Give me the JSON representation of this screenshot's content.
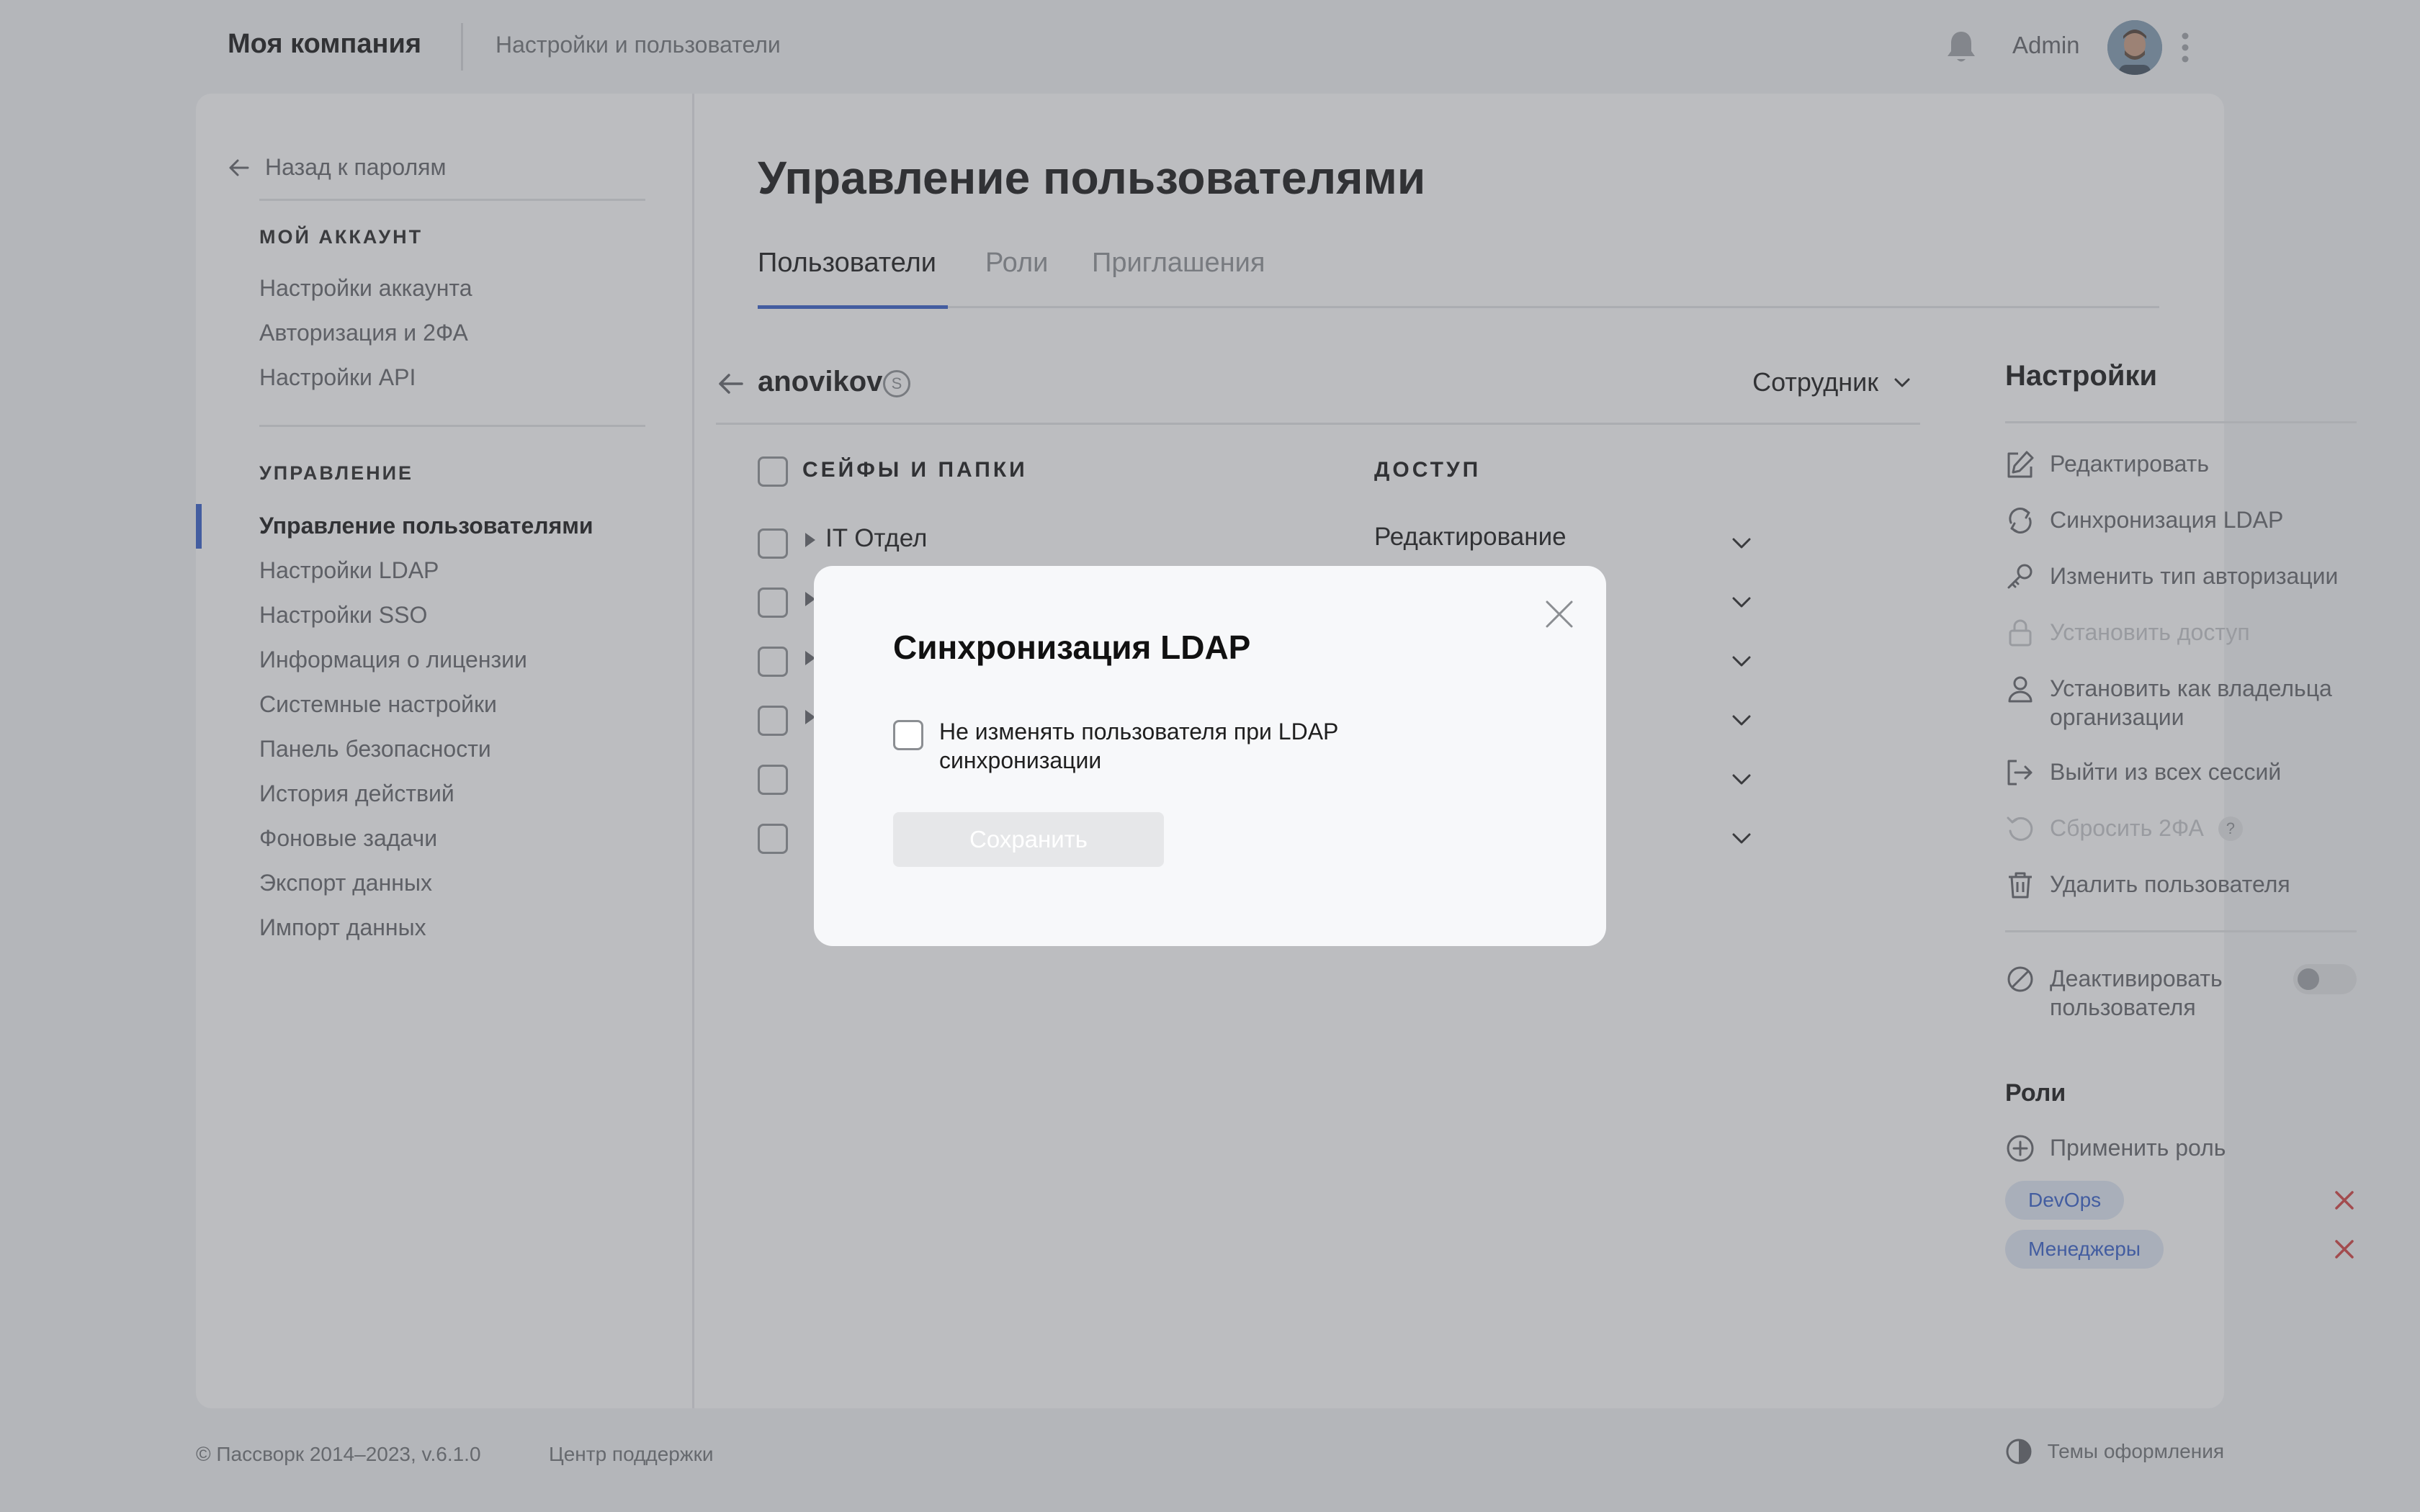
{
  "header": {
    "company": "Моя компания",
    "section": "Настройки и пользователи",
    "user_name": "Admin"
  },
  "sidebar": {
    "back_label": "Назад к паролям",
    "account_heading": "МОЙ АККАУНТ",
    "account_items": [
      "Настройки аккаунта",
      "Авторизация и 2ФА",
      "Настройки API"
    ],
    "admin_heading": "УПРАВЛЕНИЕ",
    "admin_items": [
      "Управление пользователями",
      "Настройки LDAP",
      "Настройки SSO",
      "Информация о лицензии",
      "Системные настройки",
      "Панель безопасности",
      "История действий",
      "Фоновые задачи",
      "Экспорт данных",
      "Импорт данных"
    ],
    "active_item": "Управление пользователями"
  },
  "main": {
    "title": "Управление пользователями",
    "tabs": [
      "Пользователи",
      "Роли",
      "Приглашения"
    ],
    "active_tab": "Пользователи",
    "user": {
      "username": "anovikov",
      "badge": "S",
      "role": "Сотрудник"
    },
    "table": {
      "col_safes": "СЕЙФЫ И ПАПКИ",
      "col_access": "ДОСТУП",
      "rows": [
        {
          "name": "IT Отдел",
          "access": "Редактирование"
        },
        {
          "name": "",
          "access": ""
        },
        {
          "name": "",
          "access": ""
        },
        {
          "name": "",
          "access": ""
        },
        {
          "name": "",
          "access": ""
        },
        {
          "name": "",
          "access": ""
        }
      ]
    }
  },
  "settings": {
    "title": "Настройки",
    "items": [
      {
        "icon": "edit-icon",
        "label": "Редактировать",
        "disabled": false
      },
      {
        "icon": "sync-icon",
        "label": "Синхронизация LDAP",
        "disabled": false
      },
      {
        "icon": "key-icon",
        "label": "Изменить тип авторизации",
        "disabled": false
      },
      {
        "icon": "lock-icon",
        "label": "Установить доступ",
        "disabled": true
      },
      {
        "icon": "person-icon",
        "label": "Установить как владельца организации",
        "disabled": false
      },
      {
        "icon": "logout-icon",
        "label": "Выйти из всех сессий",
        "disabled": false
      },
      {
        "icon": "reset-icon",
        "label": "Сбросить 2ФА",
        "disabled": true
      },
      {
        "icon": "trash-icon",
        "label": "Удалить пользователя",
        "disabled": false
      }
    ],
    "deactivate_label": "Деактивировать пользователя",
    "help_mark": "?",
    "roles_title": "Роли",
    "apply_role_label": "Применить роль",
    "roles": [
      "DevOps",
      "Менеджеры"
    ]
  },
  "footer": {
    "copyright": "© Пассворк 2014–2023, v.6.1.0",
    "support": "Центр поддержки",
    "themes": "Темы оформления"
  },
  "modal": {
    "title": "Синхронизация LDAP",
    "checkbox_label": "Не изменять пользователя при LDAP синхронизации",
    "save_label": "Сохранить"
  },
  "colors": {
    "accent": "#2f5bc9",
    "danger": "#d33b3b",
    "tag_bg": "#dfe7f5"
  }
}
